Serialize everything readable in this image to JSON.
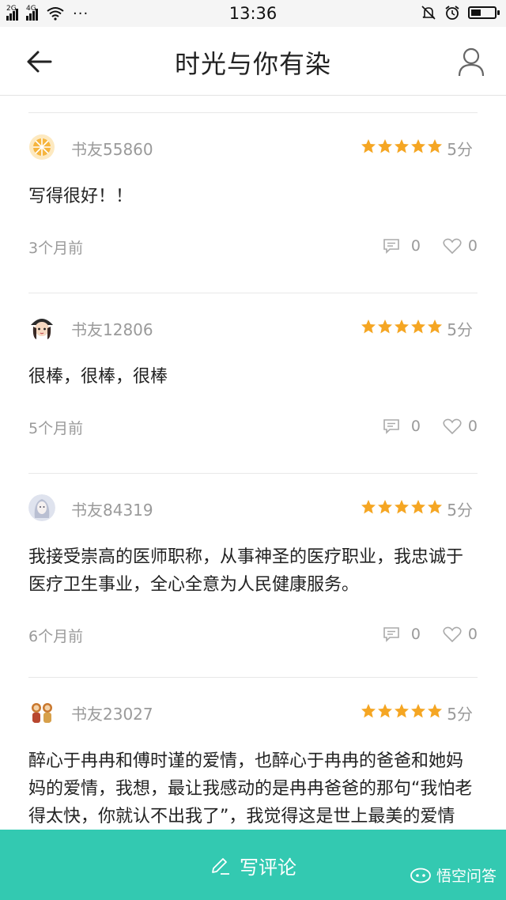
{
  "status_bar": {
    "signal1_label": "2G",
    "signal2_label": "4G",
    "more": "···",
    "time": "13:36"
  },
  "header": {
    "title": "时光与你有染"
  },
  "reviews": [
    {
      "user": "书友55860",
      "rating_stars": 5,
      "score": "5分",
      "content": "写得很好！！",
      "time": "3个月前",
      "comments": "0",
      "likes": "0"
    },
    {
      "user": "书友12806",
      "rating_stars": 5,
      "score": "5分",
      "content": "很棒，很棒，很棒",
      "time": "5个月前",
      "comments": "0",
      "likes": "0"
    },
    {
      "user": "书友84319",
      "rating_stars": 5,
      "score": "5分",
      "content": "我接受崇高的医师职称，从事神圣的医疗职业，我忠诚于医疗卫生事业，全心全意为人民健康服务。",
      "time": "6个月前",
      "comments": "0",
      "likes": "0"
    },
    {
      "user": "书友23027",
      "rating_stars": 5,
      "score": "5分",
      "content": "醉心于冉冉和傅时谨的爱情，也醉心于冉冉的爸爸和她妈妈的爱情，我想，最让我感动的是冉冉爸爸的那句“我怕老得太快，你就认不出我了”，我觉得这是世上最美的爱情"
    }
  ],
  "bottom_bar": {
    "write_label": "写评论",
    "watermark": "悟空问答"
  },
  "colors": {
    "accent": "#33c9b1",
    "star": "#f5a623",
    "muted_text": "#9a9a9a"
  }
}
